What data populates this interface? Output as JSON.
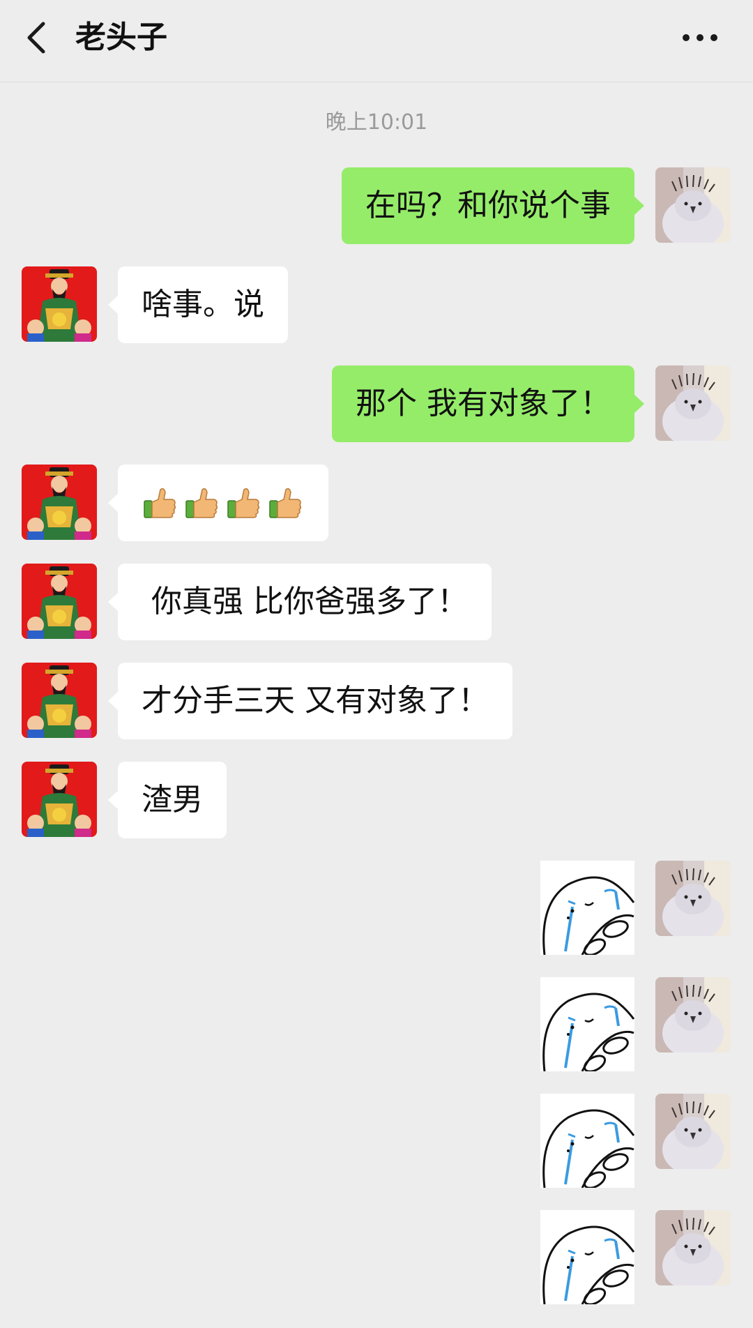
{
  "header": {
    "title": "老头子"
  },
  "timestamp": "晚上10:01",
  "messages": [
    {
      "from": "self",
      "type": "text",
      "text": "在吗？和你说个事"
    },
    {
      "from": "friend",
      "type": "text",
      "text": "啥事。说"
    },
    {
      "from": "self",
      "type": "text",
      "text": "那个 我有对象了！"
    },
    {
      "from": "friend",
      "type": "emoji",
      "emoji": "thumbs-up-icon",
      "count": 4
    },
    {
      "from": "friend",
      "type": "text",
      "text": " 你真强 比你爸强多了！"
    },
    {
      "from": "friend",
      "type": "text",
      "text": "才分手三天 又有对象了！"
    },
    {
      "from": "friend",
      "type": "text",
      "text": "渣男"
    },
    {
      "from": "self",
      "type": "sticker",
      "sticker": "crying-blob-sticker"
    },
    {
      "from": "self",
      "type": "sticker",
      "sticker": "crying-blob-sticker"
    },
    {
      "from": "self",
      "type": "sticker",
      "sticker": "crying-blob-sticker"
    },
    {
      "from": "self",
      "type": "sticker",
      "sticker": "crying-blob-sticker"
    }
  ],
  "colors": {
    "outgoing_bubble": "#95ec69",
    "incoming_bubble": "#ffffff",
    "background": "#ededed"
  }
}
